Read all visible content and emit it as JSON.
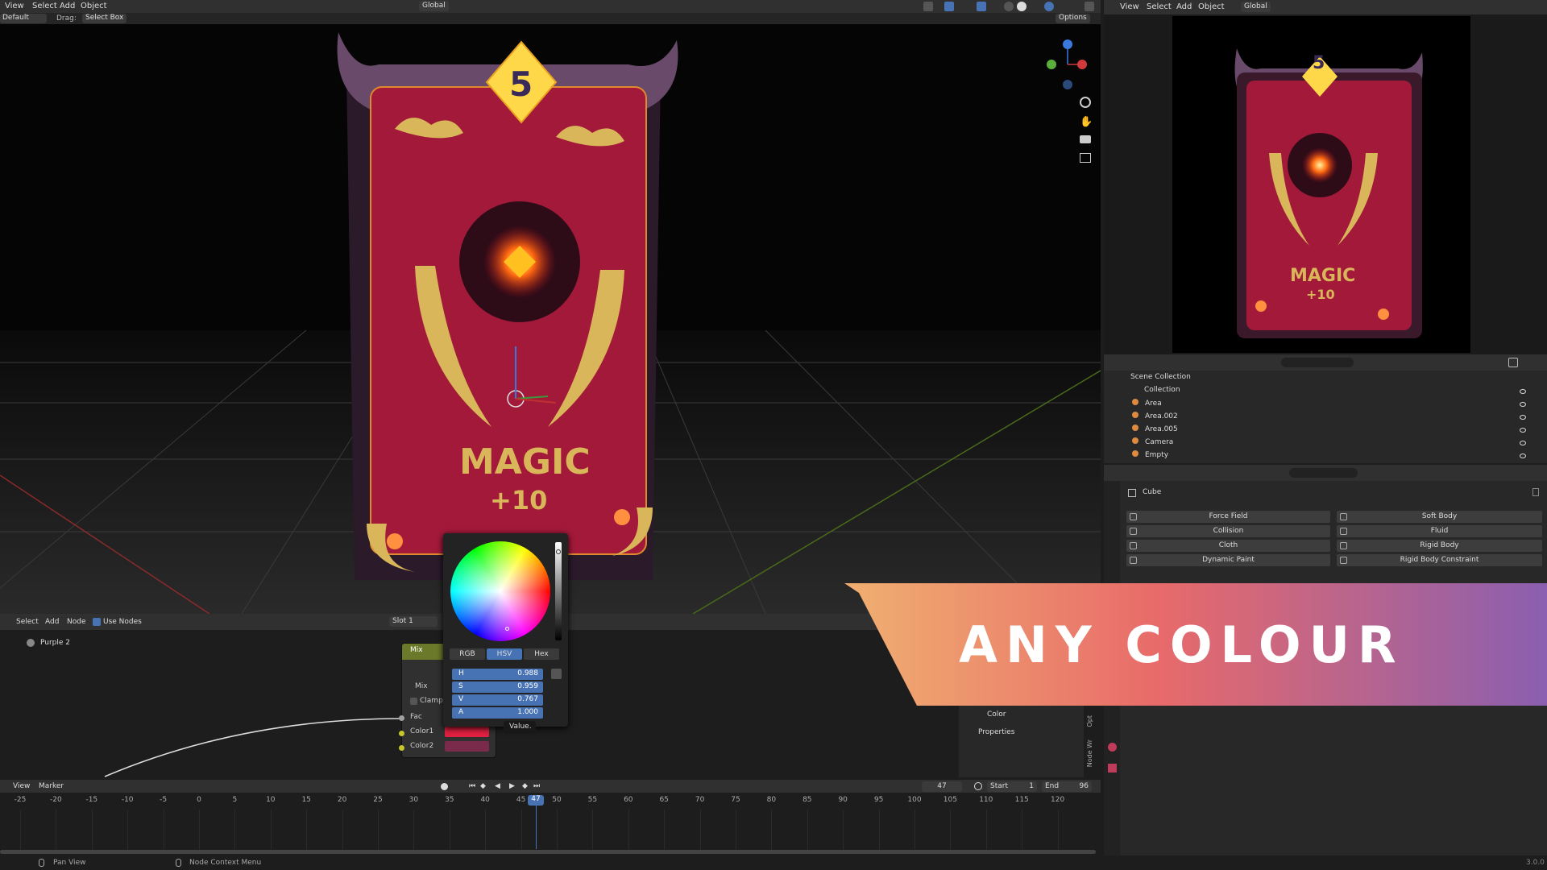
{
  "viewport_header": {
    "menus": [
      "View",
      "Select",
      "Add",
      "Object"
    ],
    "orientation": "Global",
    "mode": "Default",
    "drag_label": "Drag:",
    "drag_value": "Select Box",
    "options": "Options"
  },
  "render_header": {
    "menus": [
      "View",
      "Select",
      "Add",
      "Object"
    ],
    "orientation": "Global"
  },
  "card": {
    "number": "5",
    "title": "MAGIC",
    "bonus": "+10"
  },
  "outliner": {
    "scene": "Scene Collection",
    "collection": "Collection",
    "items": [
      "Area",
      "Area.002",
      "Area.005",
      "Camera",
      "Empty"
    ]
  },
  "properties": {
    "object": "Cube",
    "physics": [
      [
        "Force Field",
        "Soft Body"
      ],
      [
        "Collision",
        "Fluid"
      ],
      [
        "Cloth",
        "Rigid Body"
      ],
      [
        "Dynamic Paint",
        "Rigid Body Constraint"
      ]
    ],
    "panel_rows": [
      "Color",
      "Properties"
    ],
    "side_tabs": [
      "Opt",
      "Node Wr"
    ]
  },
  "node_editor": {
    "menus": [
      "Select",
      "Add",
      "Node"
    ],
    "use_nodes": "Use Nodes",
    "slot": "Slot 1",
    "material": "Purple 2",
    "mix_title": "Mix",
    "mix_type": "Mix",
    "clamp": "Clamp",
    "fac": "Fac",
    "color1": "Color1",
    "color2": "Color2"
  },
  "color_picker": {
    "tabs": [
      "RGB",
      "HSV",
      "Hex"
    ],
    "active_tab": "HSV",
    "fields": [
      [
        "H",
        "0.988"
      ],
      [
        "S",
        "0.959"
      ],
      [
        "V",
        "0.767"
      ],
      [
        "A",
        "1.000"
      ]
    ],
    "tooltip": "Value."
  },
  "timeline": {
    "menus": [
      "View",
      "Marker"
    ],
    "frame": "47",
    "start_label": "Start",
    "start": "1",
    "end_label": "End",
    "end": "96",
    "ticks": [
      "-25",
      "-20",
      "-15",
      "-10",
      "-5",
      "0",
      "5",
      "10",
      "15",
      "20",
      "25",
      "30",
      "35",
      "40",
      "45",
      "47",
      "50",
      "55",
      "60",
      "65",
      "70",
      "75",
      "80",
      "85",
      "90",
      "95",
      "100",
      "105",
      "110",
      "115",
      "120"
    ]
  },
  "status": {
    "left": "Pan View",
    "middle": "Node Context Menu",
    "version": "3.0.0"
  },
  "banner": {
    "text": "ANY COLOUR"
  },
  "colors": {
    "accent": "#4772b3",
    "card_red": "#a3193a",
    "gold": "#d9b65a",
    "banner_start": "#f0b070",
    "banner_end": "#8a5fb0"
  }
}
